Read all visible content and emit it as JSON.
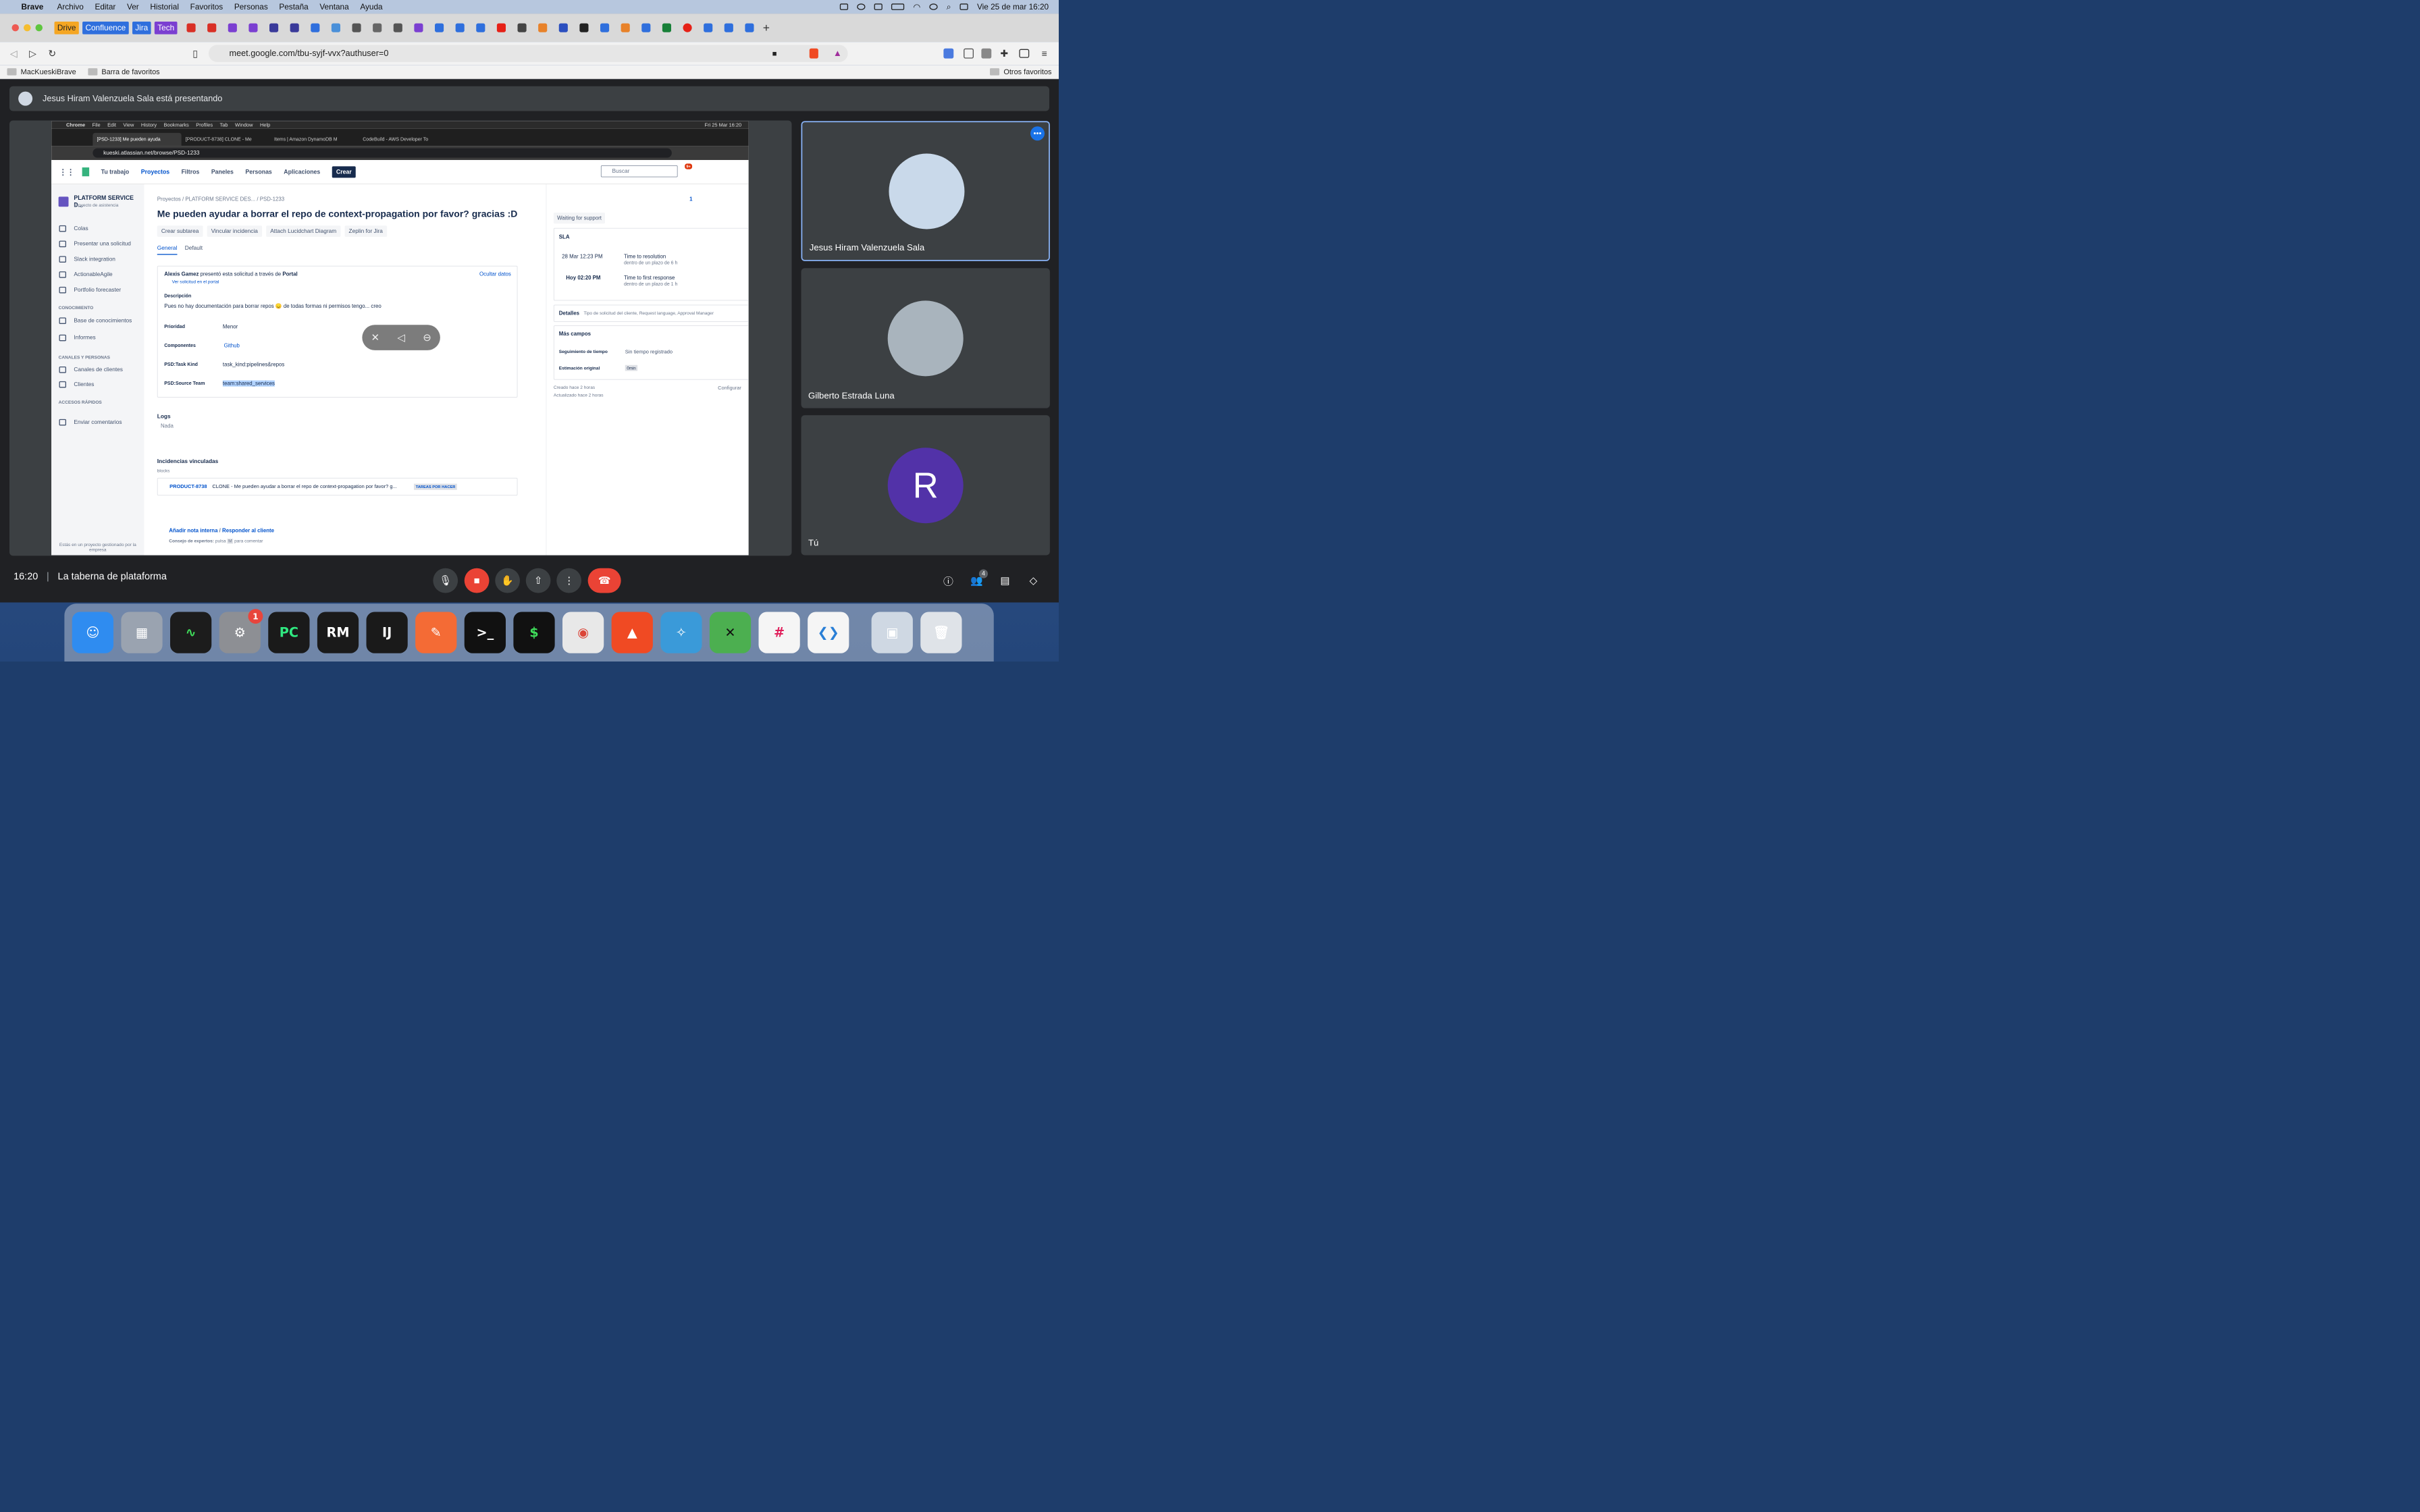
{
  "mac_menubar": {
    "app": "Brave",
    "menus": [
      "Archivo",
      "Editar",
      "Ver",
      "Historial",
      "Favoritos",
      "Personas",
      "Pestaña",
      "Ventana",
      "Ayuda"
    ],
    "datetime": "Vie 25 de mar  16:20"
  },
  "browser": {
    "bookmark_chips": [
      "Drive",
      "Confluence",
      "Jira",
      "Tech"
    ],
    "url": "meet.google.com/tbu-syjf-vvx?authuser=0",
    "favorites": [
      "MacKueskiBrave",
      "Barra de favoritos"
    ],
    "other_favorites": "Otros favoritos"
  },
  "meet": {
    "presenting_banner": "Jesus Hiram Valenzuela Sala está presentando",
    "participants": [
      {
        "name": "Jesus Hiram Valenzuela Sala"
      },
      {
        "name": "Gilberto Estrada Luna"
      },
      {
        "name": "Tú",
        "initial": "R"
      }
    ],
    "clock": "16:20",
    "meeting_name": "La taberna de plataforma",
    "participant_count": "4"
  },
  "shared_screen": {
    "menubar": [
      "Chrome",
      "File",
      "Edit",
      "View",
      "History",
      "Bookmarks",
      "Profiles",
      "Tab",
      "Window",
      "Help"
    ],
    "menubar_time": "Fri 25 Mar  16:20",
    "tabs": [
      "[PSD-1233] Me pueden ayuda",
      "[PRODUCT-8738] CLONE - Me",
      "Items | Amazon DynamoDB M",
      "CodeBuild - AWS Developer To"
    ],
    "url": "kueski.atlassian.net/browse/PSD-1233",
    "nav": [
      "Tu trabajo",
      "Proyectos",
      "Filtros",
      "Paneles",
      "Personas",
      "Aplicaciones"
    ],
    "create_label": "Crear",
    "search_placeholder": "Buscar",
    "notif_badge": "9+",
    "sidebar": {
      "project": "PLATFORM SERVICE D...",
      "project_sub": "Proyecto de asistencia",
      "items": [
        "Colas",
        "Presentar una solicitud",
        "Slack integration",
        "ActionableAgile",
        "Portfolio forecaster"
      ],
      "sec_conocimiento": "CONOCIMIENTO",
      "items2": [
        "Base de conocimientos",
        "Informes"
      ],
      "sec_canales": "CANALES Y PERSONAS",
      "items3": [
        "Canales de clientes",
        "Clientes"
      ],
      "sec_accesos": "ACCESOS RÁPIDOS",
      "items4": [
        "Enviar comentarios"
      ],
      "footer": "Estás en un proyecto gestionado por la empresa"
    },
    "issue": {
      "breadcrumb": [
        "Proyectos",
        "PLATFORM SERVICE DES...",
        "PSD-1233"
      ],
      "title": "Me pueden ayudar a borrar el repo de context-propagation por favor? gracias :D",
      "actions": [
        "Crear subtarea",
        "Vincular incidencia",
        "Attach Lucidchart Diagram",
        "Zeplin for Jira"
      ],
      "tabs": [
        "General",
        "Default"
      ],
      "requester": "Alexis Gamez",
      "requester_text": "presentó esta solicitud a través de",
      "requester_channel": "Portal",
      "view_portal": "Ver solicitud en el portal",
      "hide_data": "Ocultar datos",
      "desc_label": "Descripción",
      "desc": "Pues no hay documentación para borrar repos 😞 de todas formas ni permisos tengo... creo",
      "fields": [
        {
          "label": "Prioridad",
          "value": "Menor"
        },
        {
          "label": "Componentes",
          "value": "Github"
        },
        {
          "label": "PSD:Task Kind",
          "value": "task_kind:pipelines&repos"
        },
        {
          "label": "PSD:Source Team",
          "value": "team:shared_services"
        }
      ],
      "logs_label": "Logs",
      "logs_value": "Nada",
      "linked_label": "Incidencias vinculadas",
      "linked_type": "blocks",
      "linked_key": "PRODUCT-8738",
      "linked_summary": "CLONE - Me pueden ayudar a borrar el repo de context-propagation por favor? g...",
      "linked_status": "TAREAS POR HACER",
      "add_note": "Añadir nota interna",
      "reply": "Responder al cliente",
      "tip_prefix": "Consejo de expertos:",
      "tip_mid": "pulsa",
      "tip_key": "M",
      "tip_suffix": "para comentar"
    },
    "right_panel": {
      "watchers": "1",
      "status": "Waiting for support",
      "sla_label": "SLA",
      "sla": [
        {
          "date": "28 Mar 12:23 PM",
          "name": "Time to resolution",
          "sub": "dentro de un plazo de 6 h"
        },
        {
          "date": "Hoy 02:20 PM",
          "name": "Time to first response",
          "sub": "dentro de un plazo de 1 h"
        }
      ],
      "details_label": "Detalles",
      "details_sub": "Tipo de solicitud del cliente, Request language, Approval Manager",
      "more_label": "Más campos",
      "time_tracking_label": "Seguimiento de tiempo",
      "time_tracking_value": "Sin tiempo registrado",
      "estimate_label": "Estimación original",
      "estimate_value": "0min",
      "created": "Creado hace 2 horas",
      "updated": "Actualizado hace 2 horas",
      "configure": "Configurar"
    }
  }
}
